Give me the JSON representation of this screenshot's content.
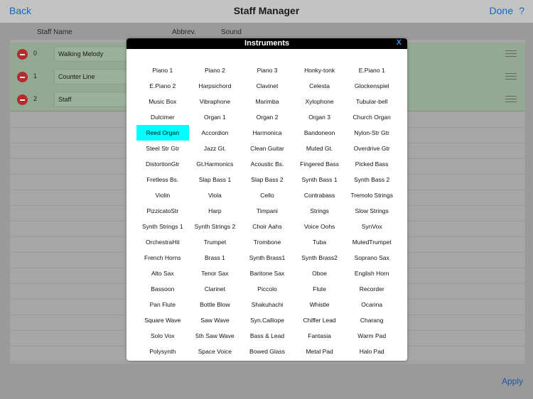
{
  "nav": {
    "back": "Back",
    "title": "Staff Manager",
    "done": "Done",
    "help": "?"
  },
  "columns": {
    "name": "Staff Name",
    "abbrev": "Abbrev.",
    "sound": "Sound"
  },
  "staffs": [
    {
      "index": "0",
      "name": "Walking Melody"
    },
    {
      "index": "1",
      "name": "Counter Line"
    },
    {
      "index": "2",
      "name": "Staff"
    }
  ],
  "apply": "Apply",
  "modal": {
    "title": "Instruments",
    "close": "X",
    "selected": "Reed Organ",
    "selected_color": "#00ffff",
    "instruments": [
      "Piano 1",
      "Piano 2",
      "Piano 3",
      "Honky-tonk",
      "E.Piano 1",
      "E.Piano 2",
      "Harpsichord",
      "Clavinet",
      "Celesta",
      "Glockenspiel",
      "Music Box",
      "Vibraphone",
      "Marimba",
      "Xylophone",
      "Tubular-bell",
      "Dulcimer",
      "Organ 1",
      "Organ 2",
      "Organ 3",
      "Church Organ",
      "Reed Organ",
      "Accordion",
      "Harmonica",
      "Bandoneon",
      "Nylon-Str Gtr",
      "Steel Str Gtr",
      "Jazz Gt.",
      "Clean Guitar",
      "Muted Gt.",
      "Overdrive Gtr",
      "DistortionGtr",
      "Gt.Harmonics",
      "Acoustic Bs.",
      "Fingered Bass",
      "Picked Bass",
      "Fretless Bs.",
      "Slap Bass 1",
      "Slap Bass 2",
      "Synth Bass 1",
      "Synth Bass 2",
      "Violin",
      "Viola",
      "Cello",
      "Contrabass",
      "Tremolo Strings",
      "PizzicatoStr",
      "Harp",
      "Timpani",
      "Strings",
      "Slow Strings",
      "Synth Strings 1",
      "Synth Strings 2",
      "Choir Aahs",
      "Voice Oohs",
      "SynVox",
      "OrchestraHit",
      "Trumpet",
      "Trombone",
      "Tuba",
      "MutedTrumpet",
      "French Horns",
      "Brass 1",
      "Synth Brass1",
      "Synth Brass2",
      "Soprano Sax",
      "Alto Sax",
      "Tenor Sax",
      "Baritone Sax",
      "Oboe",
      "English Horn",
      "Bassoon",
      "Clarinet",
      "Piccolo",
      "Flute",
      "Recorder",
      "Pan Flute",
      "Bottle Blow",
      "Shakuhachi",
      "Whistle",
      "Ocarina",
      "Square Wave",
      "Saw Wave",
      "Syn.Calliope",
      "Chiffer Lead",
      "Charang",
      "Solo Vox",
      "5th Saw Wave",
      "Bass & Lead",
      "Fantasia",
      "Warm Pad",
      "Polysynth",
      "Space Voice",
      "Bowed Glass",
      "Metal Pad",
      "Halo Pad"
    ]
  }
}
